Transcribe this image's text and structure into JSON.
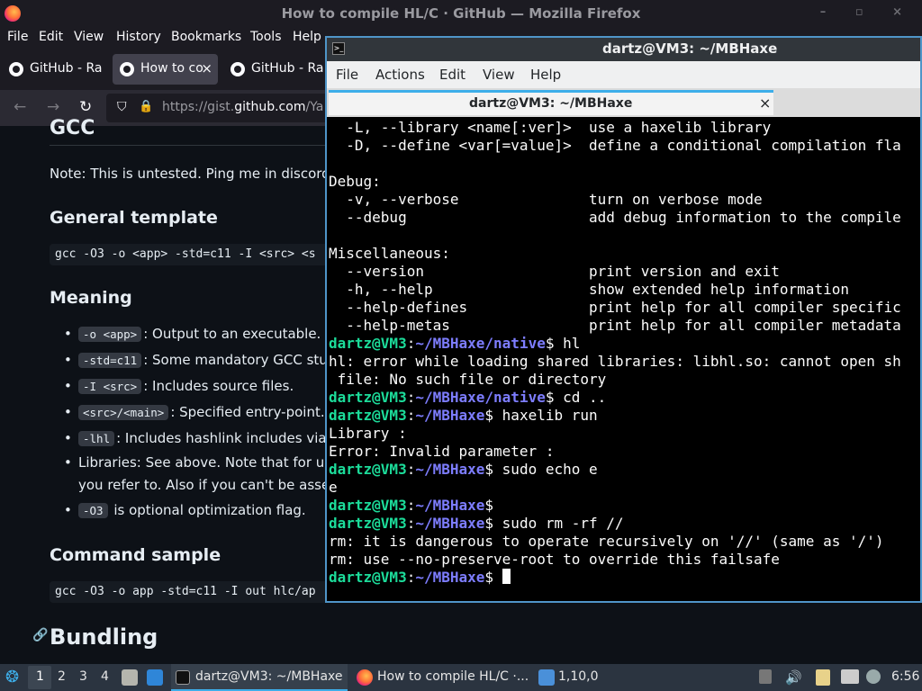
{
  "firefox": {
    "title": "How to compile HL/C · GitHub — Mozilla Firefox",
    "menu": [
      "File",
      "Edit",
      "View",
      "History",
      "Bookmarks",
      "Tools",
      "Help"
    ],
    "tabs": [
      {
        "label": "GitHub - Ra",
        "close": ""
      },
      {
        "label": "How to co",
        "close": "×"
      },
      {
        "label": "GitHub - Ra",
        "close": ""
      }
    ],
    "url_prefix": "https://gist.",
    "url_host": "github.com",
    "url_rest": "/Ya",
    "window_controls": "– ▫ ×"
  },
  "page": {
    "heading_gcc": "GCC",
    "note": "Note: This is untested. Ping me in discord i",
    "heading_template": "General template",
    "template_code": "gcc -O3 -o <app> -std=c11 -I <src> <s",
    "heading_meaning": "Meaning",
    "items": [
      {
        "code": "-o <app>",
        "text": ": Output to an executable."
      },
      {
        "code": "-std=c11",
        "text": ": Some mandatory GCC stu"
      },
      {
        "code": "-I <src>",
        "text": ": Includes source files."
      },
      {
        "code": "<src>/<main>",
        "text": ": Specified entry-point."
      },
      {
        "code": "-lhl",
        "text": ": Includes hashlink includes via"
      },
      {
        "code": "",
        "text": "Libraries: See above. Note that for unix"
      },
      {
        "code": "",
        "text": "you refer to. Also if you can't be assed:"
      },
      {
        "code": "-O3",
        "text": " is optional optimization flag."
      }
    ],
    "heading_sample": "Command sample",
    "sample_code": "gcc -O3 -o app -std=c11 -I out hlc/ap",
    "heading_bundling": "Bundling"
  },
  "terminal": {
    "title": "dartz@VM3: ~/MBHaxe",
    "menu": [
      "File",
      "Actions",
      "Edit",
      "View",
      "Help"
    ],
    "tab_title": "dartz@VM3: ~/MBHaxe",
    "tab_close": "×",
    "lines": [
      {
        "t": "  -L, --library <name[:ver]>  use a haxelib library"
      },
      {
        "t": "  -D, --define <var[=value]>  define a conditional compilation fla"
      },
      {
        "t": ""
      },
      {
        "t": "Debug:"
      },
      {
        "t": "  -v, --verbose               turn on verbose mode"
      },
      {
        "t": "  --debug                     add debug information to the compile"
      },
      {
        "t": ""
      },
      {
        "t": "Miscellaneous:"
      },
      {
        "t": "  --version                   print version and exit"
      },
      {
        "t": "  -h, --help                  show extended help information"
      },
      {
        "t": "  --help-defines              print help for all compiler specific"
      },
      {
        "t": "  --help-metas                print help for all compiler metadata"
      },
      {
        "user": "dartz@VM3",
        "path": "~/MBHaxe/native",
        "cmd": "$ hl"
      },
      {
        "t": "hl: error while loading shared libraries: libhl.so: cannot open sh"
      },
      {
        "t": " file: No such file or directory"
      },
      {
        "user": "dartz@VM3",
        "path": "~/MBHaxe/native",
        "cmd": "$ cd .."
      },
      {
        "user": "dartz@VM3",
        "path": "~/MBHaxe",
        "cmd": "$ haxelib run"
      },
      {
        "t": "Library :"
      },
      {
        "t": "Error: Invalid parameter :"
      },
      {
        "user": "dartz@VM3",
        "path": "~/MBHaxe",
        "cmd": "$ sudo echo e"
      },
      {
        "t": "e"
      },
      {
        "user": "dartz@VM3",
        "path": "~/MBHaxe",
        "cmd": "$"
      },
      {
        "user": "dartz@VM3",
        "path": "~/MBHaxe",
        "cmd": "$ sudo rm -rf //"
      },
      {
        "t": "rm: it is dangerous to operate recursively on '//' (same as '/')"
      },
      {
        "t": "rm: use --no-preserve-root to override this failsafe"
      },
      {
        "user": "dartz@VM3",
        "path": "~/MBHaxe",
        "cmd": "$ ",
        "cursor": true
      }
    ]
  },
  "taskbar": {
    "workspaces": [
      "1",
      "2",
      "3",
      "4"
    ],
    "terminal_task": "dartz@VM3: ~/MBHaxe",
    "firefox_task": "How to compile HL/C ·...",
    "files_task": "1,10,0",
    "clock": "6:56"
  },
  "colors": {
    "accent": "#3daee9",
    "prompt_user": "#1cdc9a",
    "prompt_path": "#7d7dff"
  }
}
